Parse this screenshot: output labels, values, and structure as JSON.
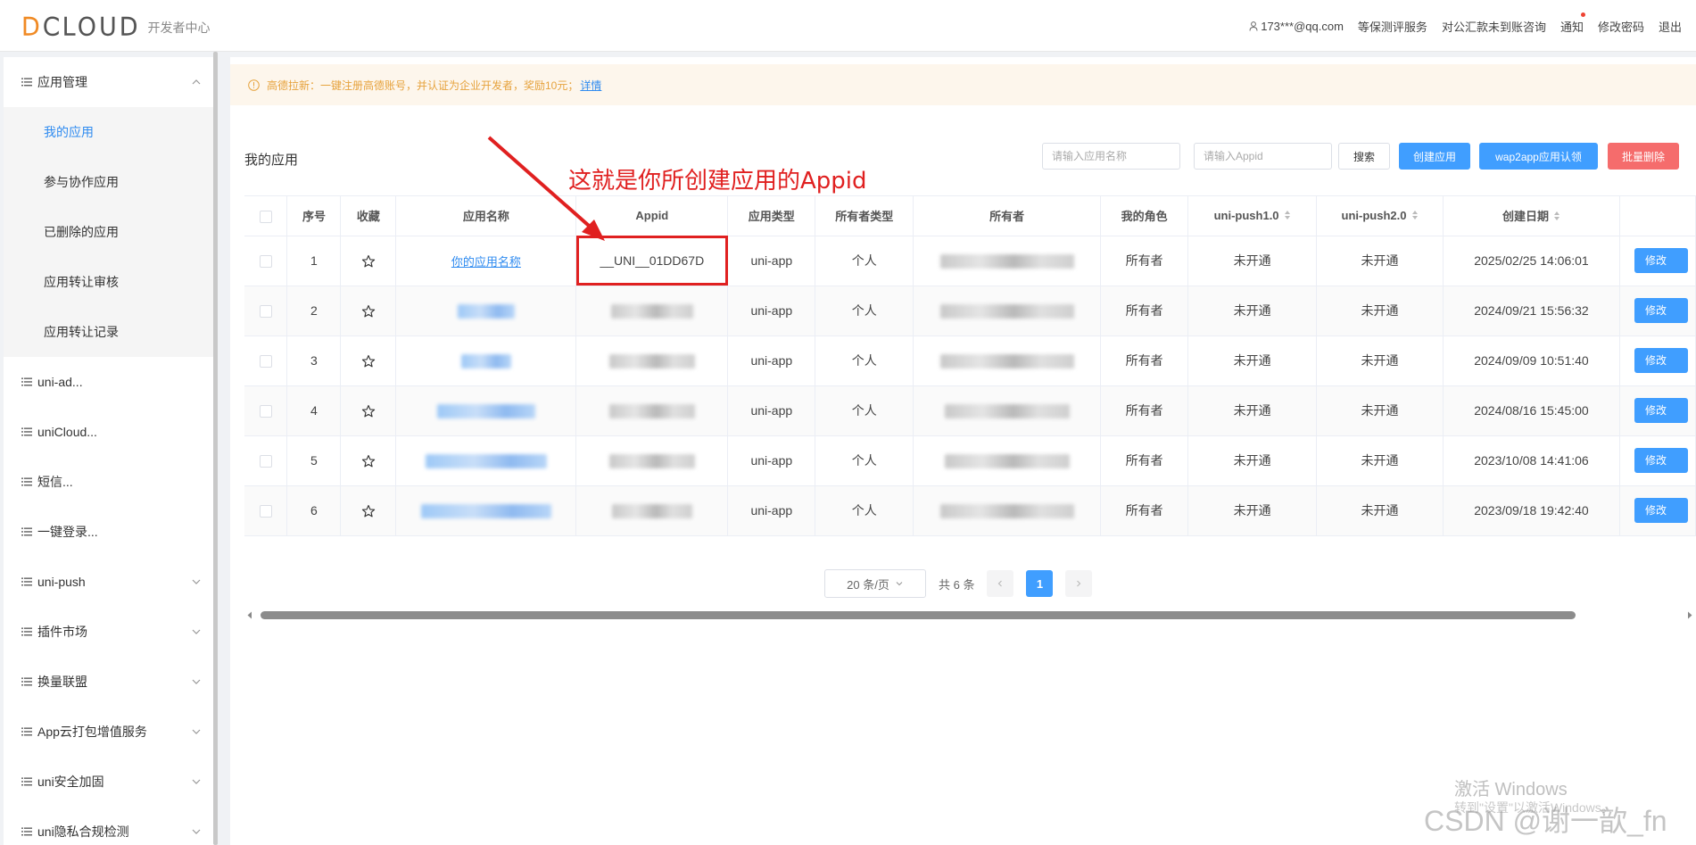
{
  "header": {
    "logo_text_d": "D",
    "logo_text_rest": "CLOUD",
    "subtitle": "开发者中心",
    "user": "173***@qq.com",
    "links": [
      "等保测评服务",
      "对公汇款未到账咨询",
      "通知",
      "修改密码",
      "退出"
    ]
  },
  "sidebar": {
    "group_app": "应用管理",
    "subitems": [
      "我的应用",
      "参与协作应用",
      "已删除的应用",
      "应用转让审核",
      "应用转让记录"
    ],
    "groups": [
      "uni-ad...",
      "uniCloud...",
      "短信...",
      "一键登录...",
      "uni-push",
      "插件市场",
      "换量联盟",
      "App云打包增值服务",
      "uni安全加固",
      "uni隐私合规检测"
    ]
  },
  "notice": {
    "text": "高德拉新：一键注册高德账号，并认证为企业开发者，奖励10元；",
    "link": "详情"
  },
  "toolbar": {
    "title": "我的应用",
    "name_placeholder": "请输入应用名称",
    "appid_placeholder": "请输入Appid",
    "search_label": "搜索",
    "create_label": "创建应用",
    "wap2app_label": "wap2app应用认领",
    "batch_delete_label": "批量删除"
  },
  "table": {
    "headers": [
      "序号",
      "收藏",
      "应用名称",
      "Appid",
      "应用类型",
      "所有者类型",
      "所有者",
      "我的角色",
      "uni-push1.0",
      "uni-push2.0",
      "创建日期"
    ],
    "edit_label": "修改",
    "rows": [
      {
        "index": "1",
        "name": "你的应用名称",
        "appid": "__UNI__01DD67D",
        "type": "uni-app",
        "owner_type": "个人",
        "role": "所有者",
        "push1": "未开通",
        "push2": "未开通",
        "date": "2025/02/25 14:06:01"
      },
      {
        "index": "2",
        "name": "",
        "appid": "",
        "type": "uni-app",
        "owner_type": "个人",
        "role": "所有者",
        "push1": "未开通",
        "push2": "未开通",
        "date": "2024/09/21 15:56:32"
      },
      {
        "index": "3",
        "name": "",
        "appid": "",
        "type": "uni-app",
        "owner_type": "个人",
        "role": "所有者",
        "push1": "未开通",
        "push2": "未开通",
        "date": "2024/09/09 10:51:40"
      },
      {
        "index": "4",
        "name": "",
        "appid": "",
        "type": "uni-app",
        "owner_type": "个人",
        "role": "所有者",
        "push1": "未开通",
        "push2": "未开通",
        "date": "2024/08/16 15:45:00"
      },
      {
        "index": "5",
        "name": "",
        "appid": "",
        "type": "uni-app",
        "owner_type": "个人",
        "role": "所有者",
        "push1": "未开通",
        "push2": "未开通",
        "date": "2023/10/08 14:41:06"
      },
      {
        "index": "6",
        "name": "",
        "appid": "",
        "type": "uni-app",
        "owner_type": "个人",
        "role": "所有者",
        "push1": "未开通",
        "push2": "未开通",
        "date": "2023/09/18 19:42:40"
      }
    ]
  },
  "pagination": {
    "page_size": "20 条/页",
    "total": "共 6 条",
    "current": "1"
  },
  "annotation": {
    "text": "这就是你所创建应用的Appid"
  },
  "watermark": {
    "activate": "激活 Windows",
    "activate_sub": "转到\"设置\"以激活Windows。",
    "csdn": "CSDN @谢一歆_fn"
  },
  "colors": {
    "primary": "#409eff",
    "danger": "#f56c6c",
    "annotation": "#e02020",
    "notice_text": "#e6a23c"
  }
}
